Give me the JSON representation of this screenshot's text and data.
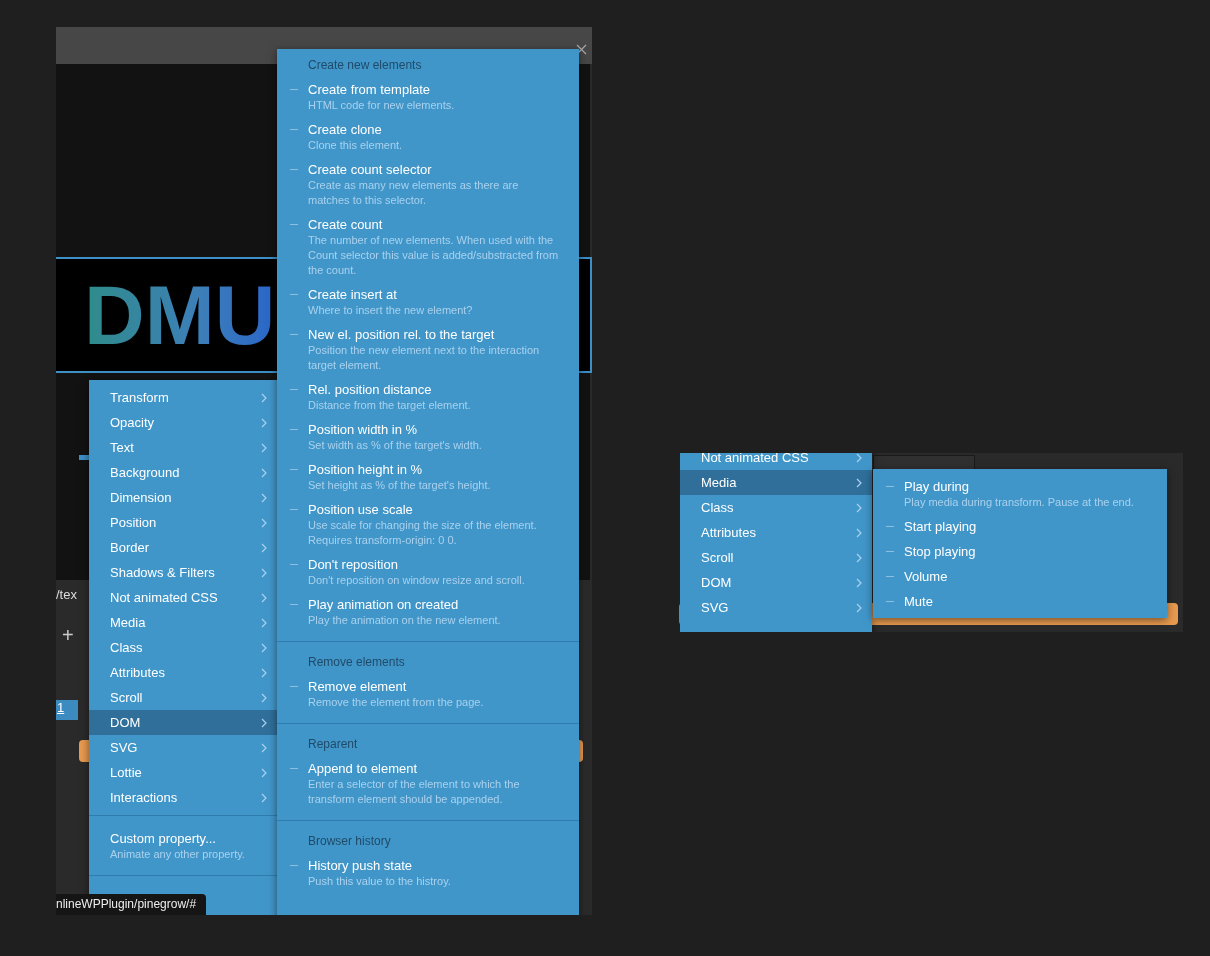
{
  "left_window": {
    "canvas_text": "DMU",
    "path_fragment": "/tex",
    "add_button": "+",
    "tab_number": "1",
    "status_url": "nlineWPPlugin/pinegrow/#",
    "menu": {
      "items": [
        {
          "label": "Transform",
          "selected": false
        },
        {
          "label": "Opacity",
          "selected": false
        },
        {
          "label": "Text",
          "selected": false
        },
        {
          "label": "Background",
          "selected": false
        },
        {
          "label": "Dimension",
          "selected": false
        },
        {
          "label": "Position",
          "selected": false
        },
        {
          "label": "Border",
          "selected": false
        },
        {
          "label": "Shadows & Filters",
          "selected": false
        },
        {
          "label": "Not animated CSS",
          "selected": false
        },
        {
          "label": "Media",
          "selected": false
        },
        {
          "label": "Class",
          "selected": false
        },
        {
          "label": "Attributes",
          "selected": false
        },
        {
          "label": "Scroll",
          "selected": false
        },
        {
          "label": "DOM",
          "selected": true
        },
        {
          "label": "SVG",
          "selected": false
        },
        {
          "label": "Lottie",
          "selected": false
        },
        {
          "label": "Interactions",
          "selected": false
        }
      ],
      "custom": {
        "title": "Custom property...",
        "description": "Animate any other property."
      }
    },
    "submenu": {
      "sections": [
        {
          "header": "Create new elements",
          "items": [
            {
              "title": "Create from template",
              "description": "HTML code for new elements."
            },
            {
              "title": "Create clone",
              "description": "Clone this element."
            },
            {
              "title": "Create count selector",
              "description": "Create as many new elements as there are matches to this selector."
            },
            {
              "title": "Create count",
              "description": "The number of new elements. When used with the Count selector this value is added/substracted from the count."
            },
            {
              "title": "Create insert at",
              "description": "Where to insert the new element?"
            },
            {
              "title": "New el. position rel. to the target",
              "description": "Position the new element next to the interaction target element."
            },
            {
              "title": "Rel. position distance",
              "description": "Distance from the target element."
            },
            {
              "title": "Position width in %",
              "description": "Set width as % of the target's width."
            },
            {
              "title": "Position height in %",
              "description": "Set height as % of the target's height."
            },
            {
              "title": "Position use scale",
              "description": "Use scale for changing the size of the element. Requires transform-origin: 0 0."
            },
            {
              "title": "Don't reposition",
              "description": "Don't reposition on window resize and scroll."
            },
            {
              "title": "Play animation on created",
              "description": "Play the animation on the new element."
            }
          ]
        },
        {
          "header": "Remove elements",
          "items": [
            {
              "title": "Remove element",
              "description": "Remove the element from the page."
            }
          ]
        },
        {
          "header": "Reparent",
          "items": [
            {
              "title": "Append to element",
              "description": "Enter a selector of the element to which the transform element should be appended."
            }
          ]
        },
        {
          "header": "Browser history",
          "items": [
            {
              "title": "History push state",
              "description": "Push this value to the histroy."
            }
          ]
        }
      ]
    }
  },
  "right_window": {
    "menu": {
      "items": [
        {
          "label": "Not animated CSS",
          "selected": false
        },
        {
          "label": "Media",
          "selected": true
        },
        {
          "label": "Class",
          "selected": false
        },
        {
          "label": "Attributes",
          "selected": false
        },
        {
          "label": "Scroll",
          "selected": false
        },
        {
          "label": "DOM",
          "selected": false
        },
        {
          "label": "SVG",
          "selected": false
        }
      ]
    },
    "submenu": {
      "items": [
        {
          "title": "Play during",
          "description": "Play media during transform. Pause at the end."
        },
        {
          "title": "Start playing"
        },
        {
          "title": "Stop playing"
        },
        {
          "title": "Volume"
        },
        {
          "title": "Mute"
        }
      ]
    }
  }
}
